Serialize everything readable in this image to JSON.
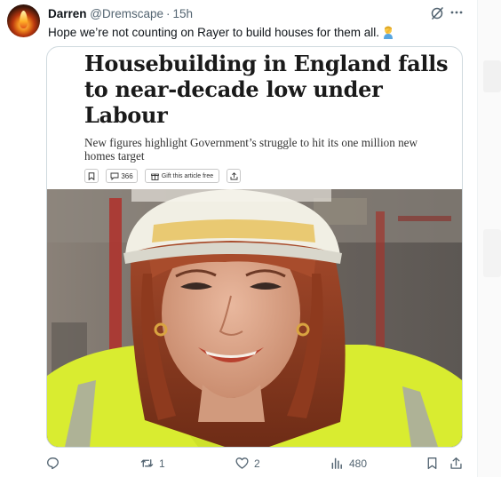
{
  "tweet": {
    "author_name": "Darren",
    "author_handle": "@Dremscape",
    "separator": "·",
    "time": "15h",
    "text": "Hope we’re not counting on Rayer to build houses for them all.",
    "emoji_icon": "person-facepalming-icon",
    "header_icons": [
      "grok-icon",
      "more-options-icon"
    ]
  },
  "article": {
    "headline": "Housebuilding in England falls to near-decade low under Labour",
    "subhead": "New figures highlight Government’s struggle to hit its one million new homes target",
    "comments_count": "366",
    "gift_label": "Gift this article free",
    "toolbar_icons": [
      "bookmark-icon",
      "comment-icon",
      "gift-icon",
      "share-icon"
    ],
    "photo_description_icon": "woman-in-hard-hat-photo"
  },
  "actions": {
    "reply_count": "",
    "retweet_count": "1",
    "like_count": "2",
    "views_count": "480",
    "icons": [
      "reply-icon",
      "retweet-icon",
      "like-icon",
      "views-icon",
      "bookmark-icon",
      "share-icon"
    ]
  },
  "colors": {
    "text_primary": "#0f1419",
    "text_secondary": "#536471",
    "border": "#cfd9de",
    "vest": "#d8ec2c",
    "helmet": "#f1efe4",
    "hair": "#8e3a1e"
  }
}
